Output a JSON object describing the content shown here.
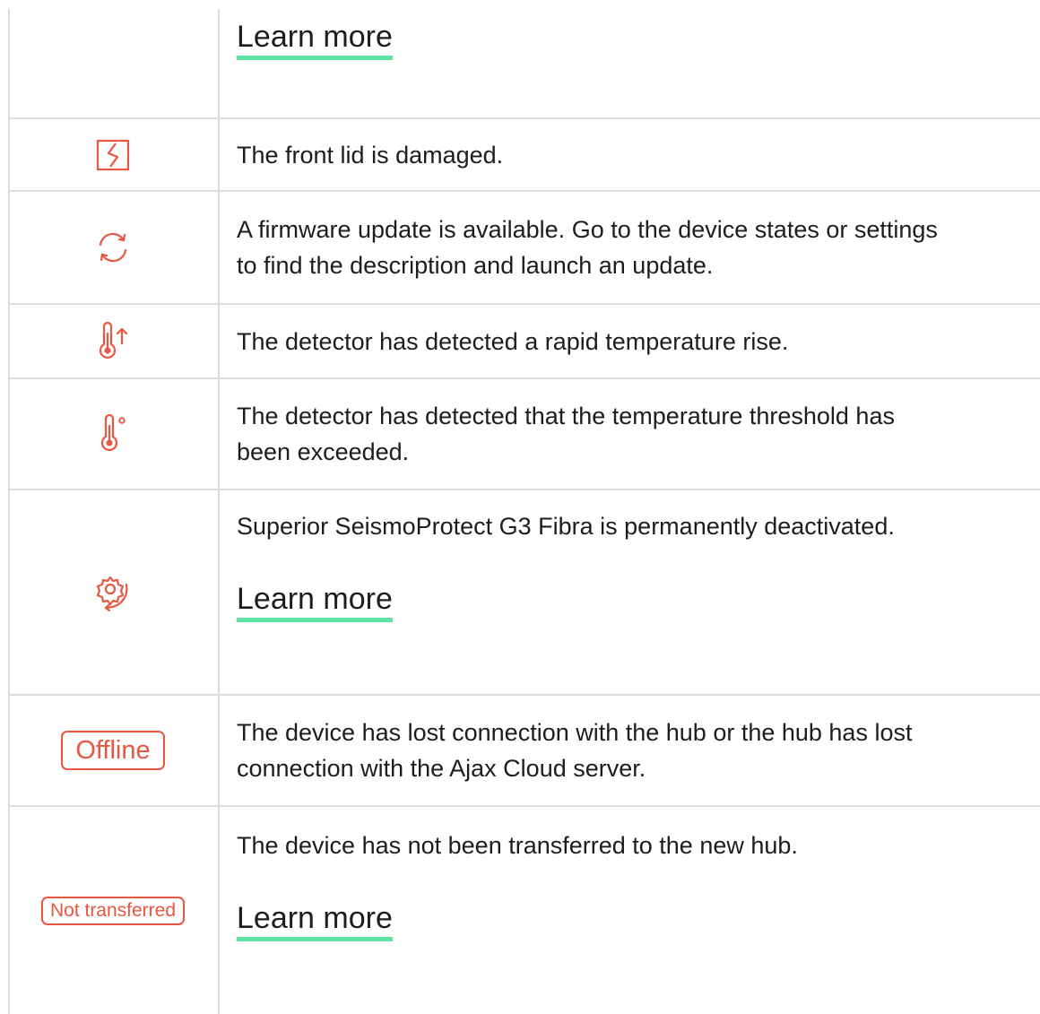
{
  "rows": [
    {
      "id": "top",
      "learn_more": "Learn more"
    },
    {
      "id": "lid",
      "icon": "damaged-lid-icon",
      "text": "The front lid is damaged."
    },
    {
      "id": "firmware",
      "icon": "firmware-update-icon",
      "text_lines": [
        "A firmware update is available. Go to the device states or settings",
        "to find the description and launch an update."
      ]
    },
    {
      "id": "rapid-temp",
      "icon": "temperature-rise-icon",
      "text": "The detector has detected a rapid temperature rise."
    },
    {
      "id": "temp-threshold",
      "icon": "temperature-threshold-icon",
      "text_lines": [
        "The detector has detected that the temperature threshold has",
        "been exceeded."
      ]
    },
    {
      "id": "deactivated",
      "icon": "permanently-deactivated-icon",
      "text": "Superior SeismoProtect G3 Fibra is permanently deactivated.",
      "learn_more": "Learn more"
    },
    {
      "id": "offline",
      "badge": "Offline",
      "text_lines": [
        "The device has lost connection with the hub or the hub has lost",
        "connection with the Ajax Cloud server."
      ]
    },
    {
      "id": "not-transferred",
      "badge": "Not transferred",
      "text": "The device has not been transferred to the new hub.",
      "learn_more": "Learn more"
    }
  ],
  "colors": {
    "accent_red": "#e8573f",
    "link_underline": "#5ee3a3",
    "border": "#dcdcdc",
    "text": "#1d1d1f"
  }
}
